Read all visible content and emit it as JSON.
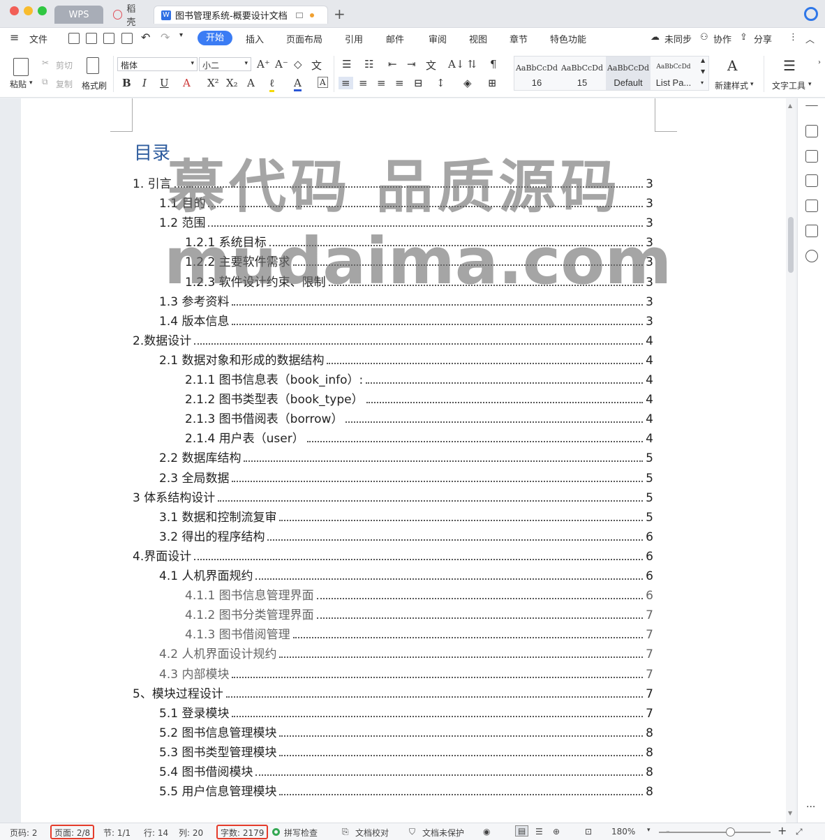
{
  "titlebar": {
    "tabs": [
      {
        "label": "WPS"
      },
      {
        "label": "稻壳"
      },
      {
        "label": "图书管理系统-概要设计文档"
      }
    ],
    "new_tab": "+"
  },
  "menubar": {
    "file": "文件",
    "tabs": [
      "开始",
      "插入",
      "页面布局",
      "引用",
      "邮件",
      "审阅",
      "视图",
      "章节",
      "特色功能"
    ],
    "right": {
      "sync": "未同步",
      "collab": "协作",
      "share": "分享"
    }
  },
  "ribbon": {
    "paste": "粘贴",
    "cut": "剪切",
    "copy": "复制",
    "format_painter": "格式刷",
    "font_name": "楷体",
    "font_size": "小二",
    "styles": [
      {
        "sample": "AaBbCcDd",
        "name": "16"
      },
      {
        "sample": "AaBbCcDd",
        "name": "15"
      },
      {
        "sample": "AaBbCcDd",
        "name": "Default"
      },
      {
        "sample": "AaBbCcDd",
        "name": "List Pa..."
      }
    ],
    "new_style": "新建样式",
    "text_tools": "文字工具"
  },
  "document": {
    "toc_title": "目录",
    "toc": [
      {
        "label": "1. 引言",
        "page": "3",
        "level": 1
      },
      {
        "label": "1.1 目的",
        "page": "3",
        "level": 2
      },
      {
        "label": "1.2 范围",
        "page": "3",
        "level": 2
      },
      {
        "label": "1.2.1 系统目标",
        "page": "3",
        "level": 3
      },
      {
        "label": "1.2.2 主要软件需求",
        "page": "3",
        "level": 3
      },
      {
        "label": "1.2.3 软件设计约束、限制",
        "page": "3",
        "level": 3
      },
      {
        "label": "1.3 参考资料",
        "page": "3",
        "level": 2
      },
      {
        "label": "1.4 版本信息",
        "page": "3",
        "level": 2
      },
      {
        "label": "2.数据设计",
        "page": "4",
        "level": 1
      },
      {
        "label": "2.1 数据对象和形成的数据结构",
        "page": "4",
        "level": 2
      },
      {
        "label": "2.1.1 图书信息表（book_info）:",
        "page": "4",
        "level": 3
      },
      {
        "label": "2.1.2 图书类型表（book_type）",
        "page": "4",
        "level": 3
      },
      {
        "label": "2.1.3 图书借阅表（borrow）",
        "page": "4",
        "level": 3
      },
      {
        "label": "2.1.4 用户表（user）",
        "page": "4",
        "level": 3
      },
      {
        "label": "2.2 数据库结构",
        "page": "5",
        "level": 2
      },
      {
        "label": "2.3 全局数据",
        "page": "5",
        "level": 2
      },
      {
        "label": "3 体系结构设计",
        "page": "5",
        "level": 1
      },
      {
        "label": "3.1 数据和控制流复审",
        "page": "5",
        "level": 2
      },
      {
        "label": "3.2 得出的程序结构",
        "page": "6",
        "level": 2
      },
      {
        "label": "4.界面设计",
        "page": "6",
        "level": 1
      },
      {
        "label": "4.1 人机界面规约",
        "page": "6",
        "level": 2
      },
      {
        "label": "4.1.1 图书信息管理界面",
        "page": "6",
        "level": 3
      },
      {
        "label": "4.1.2 图书分类管理界面",
        "page": "7",
        "level": 3
      },
      {
        "label": "4.1.3 图书借阅管理",
        "page": "7",
        "level": 3
      },
      {
        "label": "4.2 人机界面设计规约",
        "page": "7",
        "level": 2
      },
      {
        "label": "4.3 内部模块",
        "page": "7",
        "level": 2
      },
      {
        "label": "5、模块过程设计",
        "page": "7",
        "level": 1
      },
      {
        "label": "5.1 登录模块",
        "page": "7",
        "level": 2
      },
      {
        "label": "5.2 图书信息管理模块",
        "page": "8",
        "level": 2
      },
      {
        "label": "5.3 图书类型管理模块",
        "page": "8",
        "level": 2
      },
      {
        "label": "5.4 图书借阅模块",
        "page": "8",
        "level": 2
      },
      {
        "label": "5.5 用户信息管理模块",
        "page": "8",
        "level": 2
      }
    ],
    "watermark_line1": "慕代码 品质源码",
    "watermark_line2": "mudaima.com"
  },
  "statusbar": {
    "page_no": "页码: 2",
    "pages": "页面: 2/8",
    "section": "节: 1/1",
    "row": "行: 14",
    "col": "列: 20",
    "word_count": "字数: 2179",
    "spell_check": "拼写检查",
    "doc_proof": "文档校对",
    "doc_unprotected": "文档未保护",
    "zoom": "180%",
    "zoom_minus": "-",
    "zoom_plus": "+"
  },
  "colors": {
    "accent": "#3b7cf4",
    "toc_title": "#2e5c9e",
    "highlight_box": "#e53b2a"
  }
}
